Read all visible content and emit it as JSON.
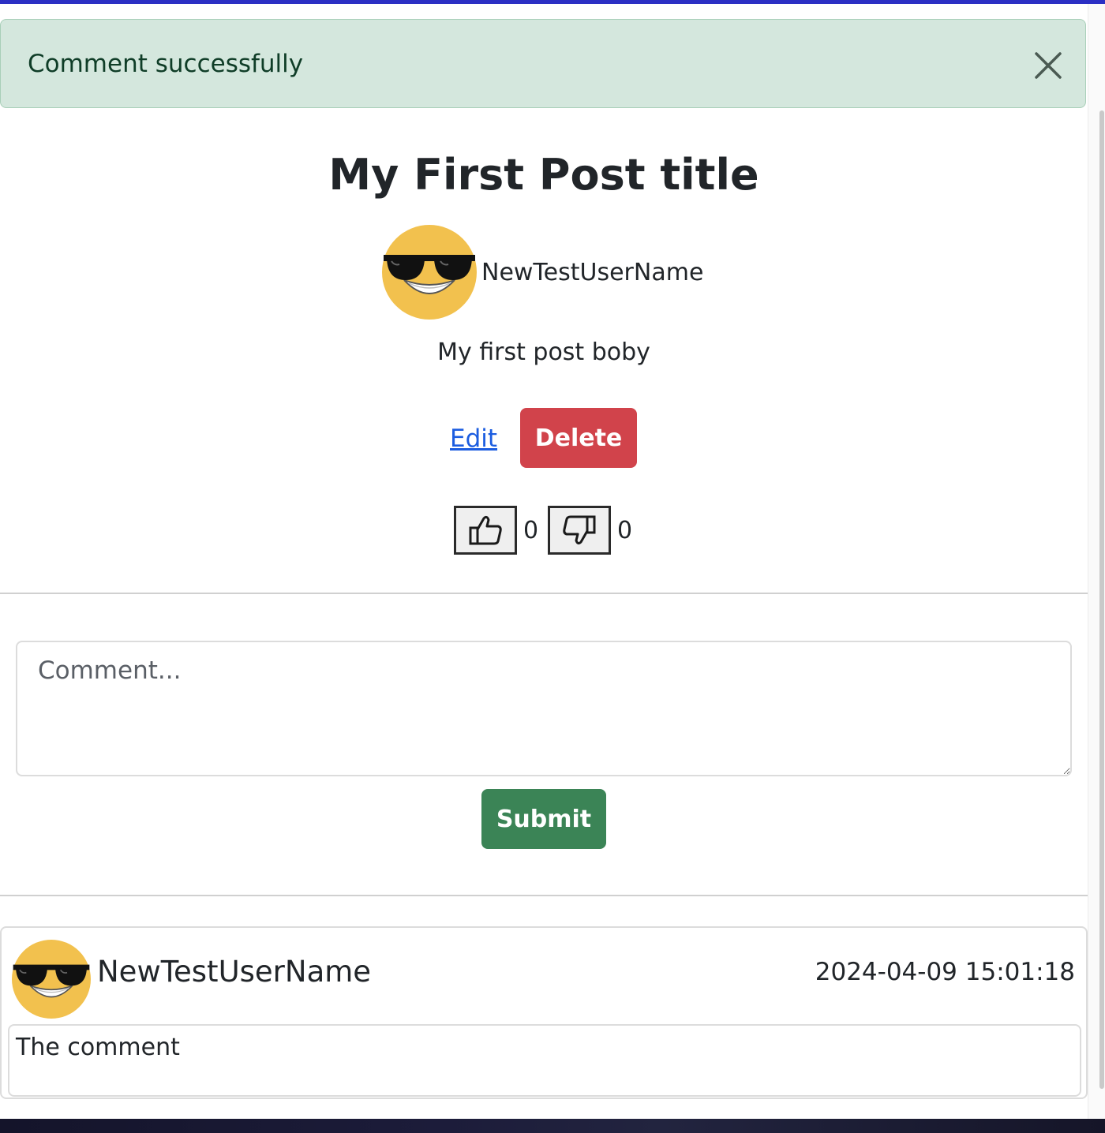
{
  "alert": {
    "message": "Comment successfully",
    "close_icon": "close-icon",
    "color": "#d4e7dd"
  },
  "post": {
    "title": "My First Post title",
    "author": "NewTestUserName",
    "avatar_icon": "sunglasses-smiley-icon",
    "body": "My first post boby",
    "edit_label": "Edit",
    "delete_label": "Delete",
    "likes": "0",
    "dislikes": "0"
  },
  "comment_form": {
    "placeholder": "Comment...",
    "value": "",
    "submit_label": "Submit"
  },
  "comments": [
    {
      "author": "NewTestUserName",
      "timestamp": "2024-04-09 15:01:18",
      "body": "The comment"
    }
  ],
  "colors": {
    "delete": "#d1434b",
    "submit": "#3b8456",
    "link": "#1c5de0",
    "avatar": "#f2c14e"
  }
}
